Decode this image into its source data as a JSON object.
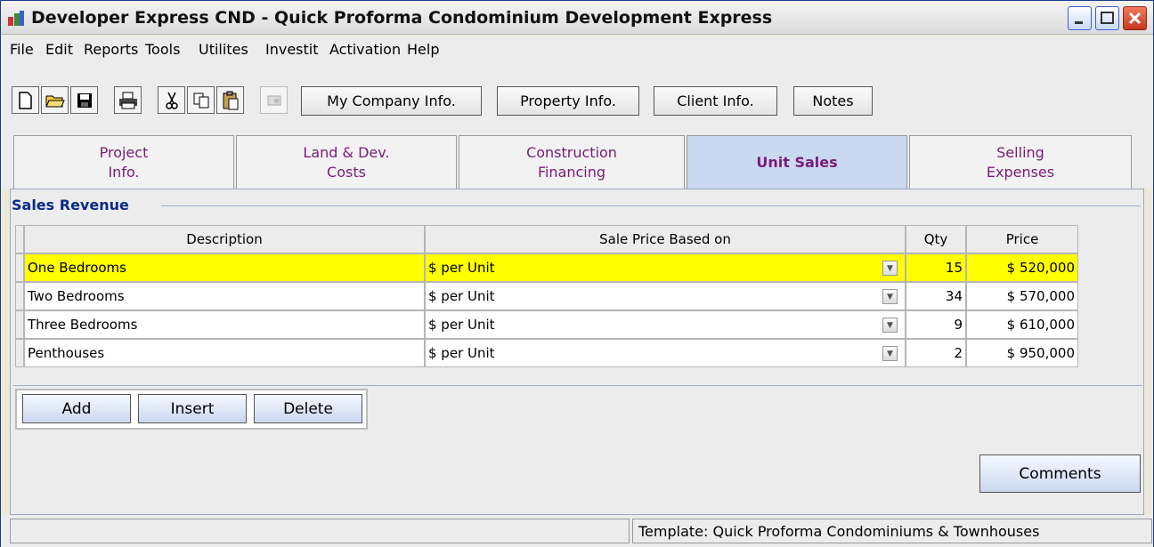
{
  "window": {
    "title": "Developer Express  CND - Quick Proforma Condominium Development  Express"
  },
  "menu": {
    "items": [
      "File",
      "Edit",
      "Reports",
      "Tools",
      "Utilites",
      "Investit",
      "Activation",
      "Help"
    ]
  },
  "toolbar": {
    "icons": [
      "new-document-icon",
      "open-folder-icon",
      "save-icon",
      "print-icon",
      "cut-icon",
      "copy-icon",
      "paste-icon",
      "disabled-tool-icon"
    ],
    "buttons": {
      "company": "My Company Info.",
      "property": "Property Info.",
      "client": "Client Info.",
      "notes": "Notes"
    }
  },
  "tabs": [
    {
      "line1": "Project",
      "line2": "Info."
    },
    {
      "line1": "Land & Dev.",
      "line2": "Costs"
    },
    {
      "line1": "Construction",
      "line2": "Financing"
    },
    {
      "line1": "Unit Sales",
      "line2": ""
    },
    {
      "line1": "Selling",
      "line2": "Expenses"
    }
  ],
  "active_tab": "Unit Sales",
  "section": {
    "title": "Sales Revenue"
  },
  "grid": {
    "columns": {
      "description": "Description",
      "sale_price": "Sale Price Based on",
      "qty": "Qty",
      "price": "Price"
    },
    "rows": [
      {
        "description": "One Bedrooms",
        "basis": "$ per Unit",
        "qty": "15",
        "price": "$ 520,000",
        "selected": true
      },
      {
        "description": "Two Bedrooms",
        "basis": "$ per Unit",
        "qty": "34",
        "price": "$ 570,000",
        "selected": false
      },
      {
        "description": "Three Bedrooms",
        "basis": "$ per Unit",
        "qty": "9",
        "price": "$ 610,000",
        "selected": false
      },
      {
        "description": "Penthouses",
        "basis": "$ per Unit",
        "qty": "2",
        "price": "$ 950,000",
        "selected": false
      }
    ]
  },
  "actions": {
    "add": "Add",
    "insert": "Insert",
    "delete": "Delete"
  },
  "comments": "Comments",
  "status": {
    "template": "Template: Quick Proforma Condominiums & Townhouses"
  },
  "colors": {
    "selected_row": "#ffff00",
    "tab_text": "#7a1a7a",
    "section_title": "#0a2a8a",
    "active_tab_bg": "#c9daf0"
  }
}
